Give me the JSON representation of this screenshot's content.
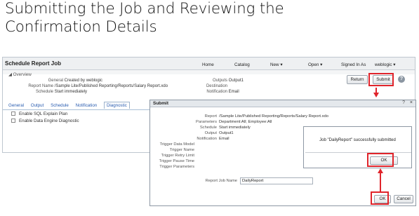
{
  "slide": {
    "title_line1": "Submitting the Job and Reviewing the",
    "title_line2": "Confirmation Details"
  },
  "app": {
    "title": "Schedule Report Job",
    "nav": {
      "home": "Home",
      "catalog": "Catalog",
      "new": "New",
      "open": "Open",
      "signed_in": "Signed In As",
      "user": "weblogic"
    },
    "overview_label": "Overview",
    "general_label": "General",
    "general_value": "Created by weblogic",
    "report_name_label": "Report Name",
    "report_name_value": "/Sample Lite/Published Reporting/Reports/Salary Report.xdo",
    "schedule_label": "Schedule",
    "schedule_value": "Start immediately",
    "outputs_label": "Outputs",
    "outputs_value": "Output1",
    "destination_label": "Destination",
    "destination_value": "",
    "notification_label": "Notification",
    "notification_value": "Email",
    "return_button": "Return",
    "submit_button": "Submit",
    "help_icon": "help-icon",
    "tabs": [
      "General",
      "Output",
      "Schedule",
      "Notification",
      "Diagnostic"
    ],
    "active_tab": "Diagnostic",
    "checkboxes": [
      "Enable SQL Explain Plan",
      "Enable Data Engine Diagnostic"
    ]
  },
  "dialog": {
    "title": "Submit",
    "help_glyph": "?",
    "close_glyph": "×",
    "rows": [
      {
        "label": "Report",
        "value": "/Sample Lite/Published Reporting/Reports/Salary Report.xdo"
      },
      {
        "label": "Parameters",
        "value": "Department:All; Employee:All"
      },
      {
        "label": "Schedule",
        "value": "Start immediately"
      },
      {
        "label": "Output",
        "value": "Output1"
      },
      {
        "label": "Notification",
        "value": "Email"
      },
      {
        "label": "Trigger Data Model",
        "value": ""
      },
      {
        "label": "Trigger Name",
        "value": ""
      },
      {
        "label": "Trigger Retry Limit",
        "value": ""
      },
      {
        "label": "Trigger Pause Time",
        "value": ""
      },
      {
        "label": "Trigger Parameters",
        "value": ""
      }
    ],
    "job_name_label": "Report Job Name",
    "job_name_value": "DailyReport",
    "ok_button": "OK",
    "cancel_button": "Cancel"
  },
  "confirm": {
    "message": "Job \"DailyReport\" successfully submitted",
    "ok_button": "OK"
  },
  "colors": {
    "highlight": "#e0242b",
    "link": "#2a5db0"
  }
}
